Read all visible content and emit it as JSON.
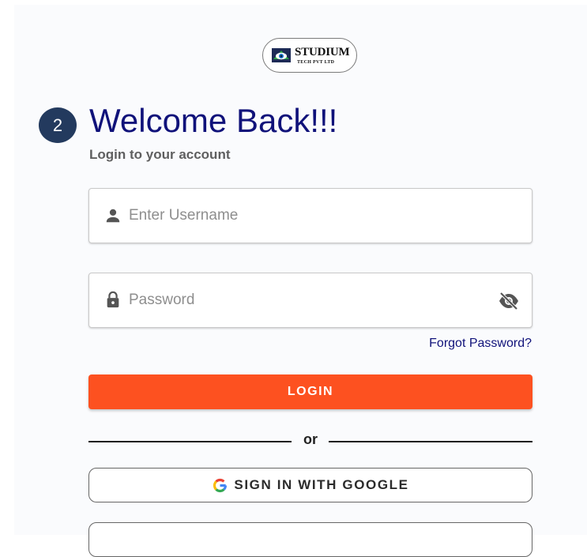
{
  "logo": {
    "name": "STUDIUM",
    "tagline": "TECH PVT LTD"
  },
  "step_badge": "2",
  "heading": {
    "title": "Welcome Back!!!",
    "subtitle": "Login to your account"
  },
  "form": {
    "username": {
      "value": "",
      "placeholder": "Enter Username",
      "icon": "person-icon"
    },
    "password": {
      "value": "",
      "placeholder": "Password",
      "icon": "lock-icon",
      "toggle_icon": "eye-off-icon"
    },
    "forgot_label": "Forgot Password?",
    "login_label": "LOGIN"
  },
  "divider_label": "or",
  "google_label": "SIGN IN WITH GOOGLE",
  "colors": {
    "accent": "#fd5120",
    "heading": "#10127a",
    "badge": "#233a5e"
  }
}
